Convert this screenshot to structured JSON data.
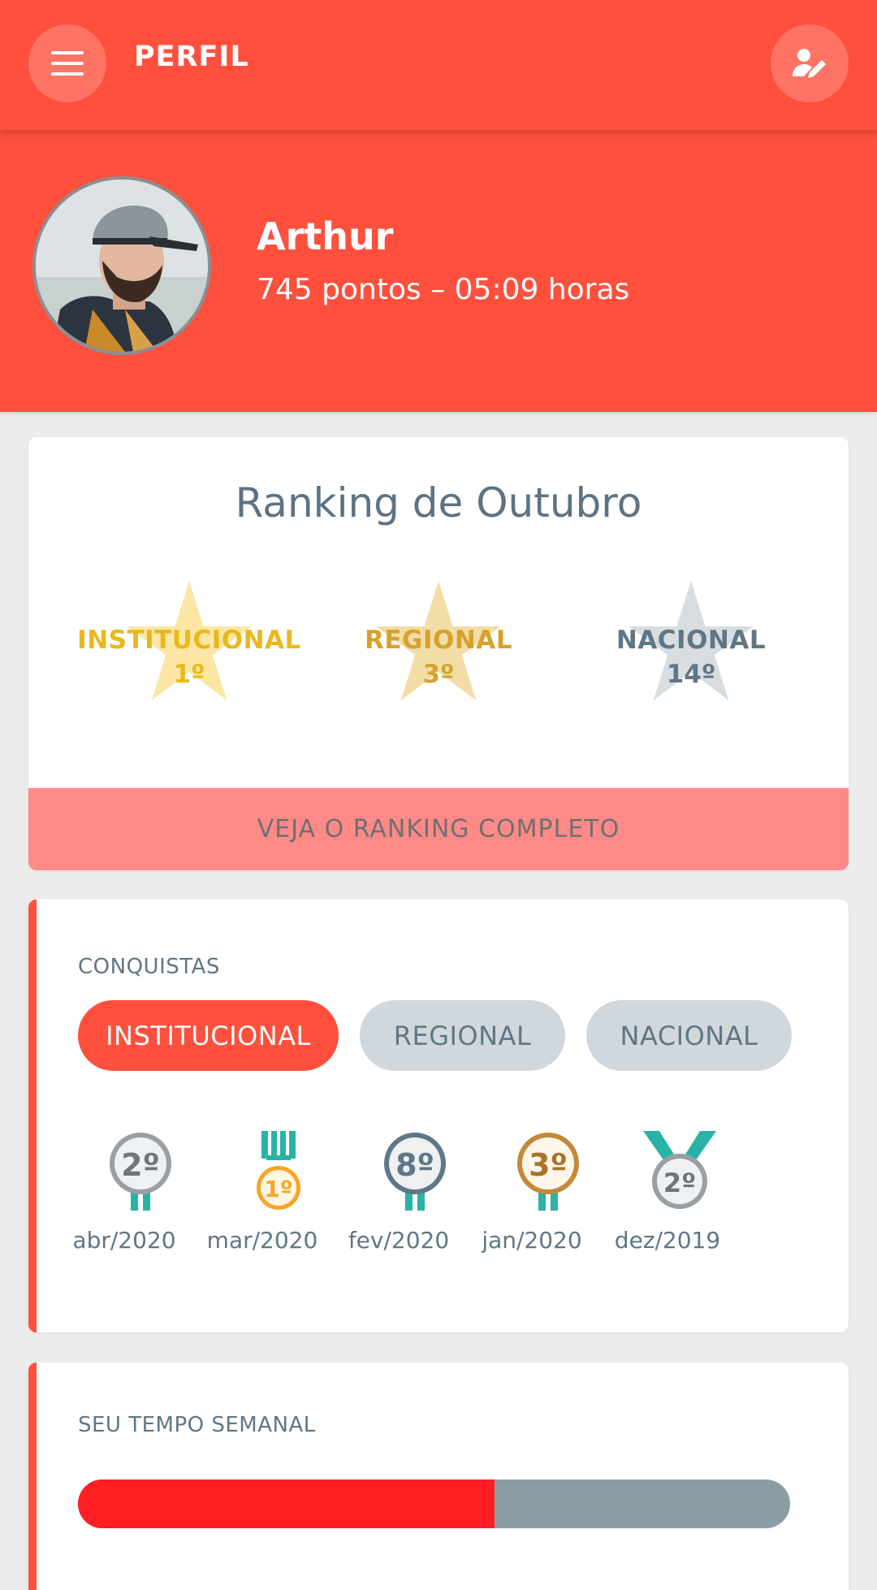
{
  "appbar": {
    "title": "PERFIL",
    "menu_icon": "menu-icon",
    "edit_icon": "edit-profile-icon",
    "color": "#fe503d"
  },
  "profile": {
    "name": "Arthur",
    "stats": "745 pontos – 05:09 horas"
  },
  "ranking": {
    "title": "Ranking de Outubro",
    "stars": [
      {
        "label": "INSTITUCIONAL",
        "position": "1º",
        "text_color": "#e8b81c",
        "star_color": "#fbe6a4"
      },
      {
        "label": "REGIONAL",
        "position": "3º",
        "text_color": "#d7a12d",
        "star_color": "#f2dda7"
      },
      {
        "label": "NACIONAL",
        "position": "14º",
        "text_color": "#617684",
        "star_color": "#d7dde1"
      }
    ],
    "button_label": "VEJA O RANKING COMPLETO"
  },
  "conquistas": {
    "title": "CONQUISTAS",
    "tabs": [
      {
        "label": "INSTITUCIONAL",
        "active": true
      },
      {
        "label": "REGIONAL",
        "active": false
      },
      {
        "label": "NACIONAL",
        "active": false
      }
    ],
    "medals": [
      {
        "rank": "2º",
        "date": "abr/2020",
        "icon": "silver-medal-icon"
      },
      {
        "rank": "1º",
        "date": "mar/2020",
        "icon": "gold-medal-icon"
      },
      {
        "rank": "8º",
        "date": "fev/2020",
        "icon": "steel-medal-icon"
      },
      {
        "rank": "3º",
        "date": "jan/2020",
        "icon": "bronze-medal-icon"
      },
      {
        "rank": "2º",
        "date": "dez/2019",
        "icon": "silver-medal-icon"
      }
    ]
  },
  "weekly_time": {
    "title": "SEU TEMPO SEMANAL",
    "progress_fraction": 0.585
  }
}
